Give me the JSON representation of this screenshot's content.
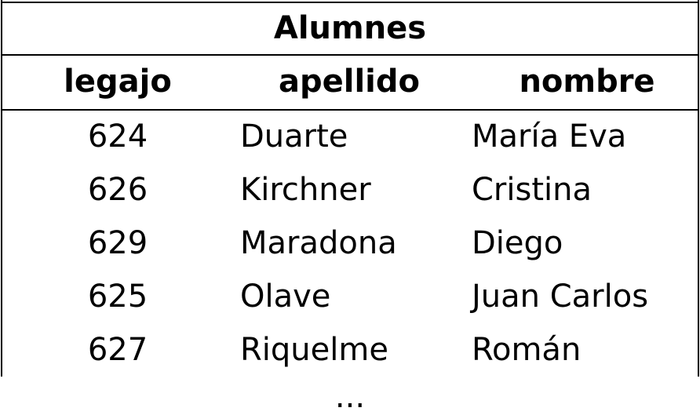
{
  "table": {
    "caption": "Alumnes",
    "headers": [
      "legajo",
      "apellido",
      "nombre"
    ],
    "rows": [
      {
        "legajo": "624",
        "apellido": "Duarte",
        "nombre": "María Eva"
      },
      {
        "legajo": "626",
        "apellido": "Kirchner",
        "nombre": "Cristina"
      },
      {
        "legajo": "629",
        "apellido": "Maradona",
        "nombre": "Diego"
      },
      {
        "legajo": "625",
        "apellido": "Olave",
        "nombre": "Juan Carlos"
      },
      {
        "legajo": "627",
        "apellido": "Riquelme",
        "nombre": "Román"
      }
    ],
    "continuation": "..."
  }
}
